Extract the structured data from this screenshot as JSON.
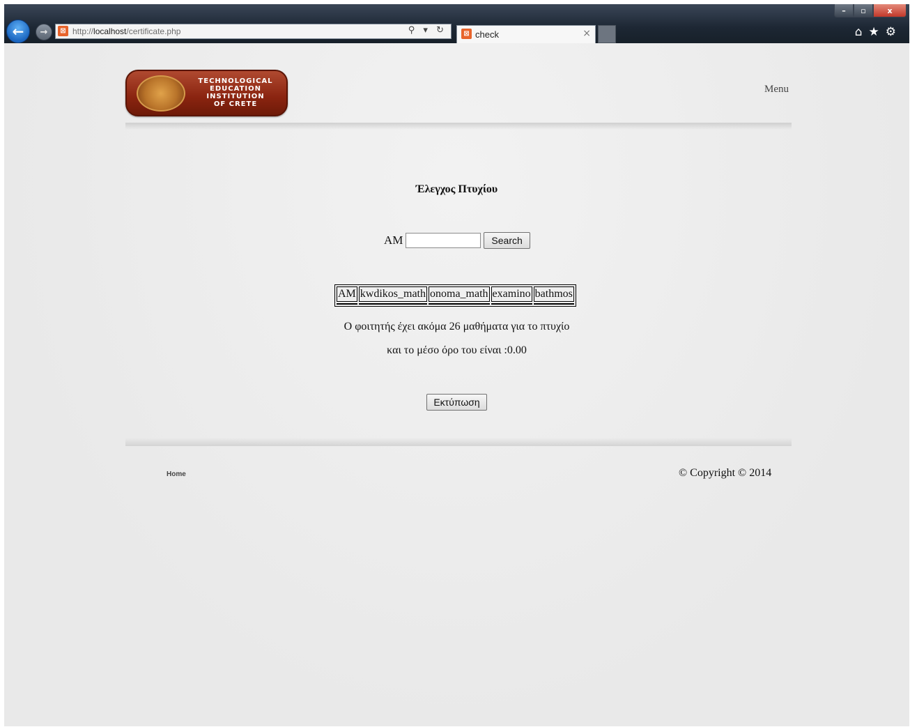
{
  "browser": {
    "url_prefix": "http://",
    "url_host": "localhost",
    "url_path": "/certificate.php",
    "tab_title": "check",
    "back_glyph": "←",
    "forward_glyph": "→",
    "search_glyphs": "⚲ ▾ ↻",
    "tab_close": "×",
    "toolbar_glyphs": "⌂★⚙",
    "window_buttons": {
      "minimize": "–",
      "maximize": "▫",
      "close": "x"
    }
  },
  "header": {
    "logo_lines": [
      "TECHNOLOGICAL",
      "EDUCATION",
      "INSTITUTION",
      "OF CRETE"
    ],
    "menu_label": "Menu"
  },
  "main": {
    "title": "Έλεγχος Πτυχίου",
    "search": {
      "label": "AM",
      "value": "",
      "button_label": "Search"
    },
    "table": {
      "columns": [
        "AM",
        "kwdikos_math",
        "onoma_math",
        "examino",
        "bathmos"
      ]
    },
    "message_remaining": "Ο φοιτητής έχει ακόμα 26 μαθήματα για το πτυχίο",
    "message_average": "και το μέσο όρο του είναι :0.00",
    "print_button": "Εκτύπωση"
  },
  "footer": {
    "home_link": "Home",
    "copyright": "© Copyright © 2014"
  }
}
